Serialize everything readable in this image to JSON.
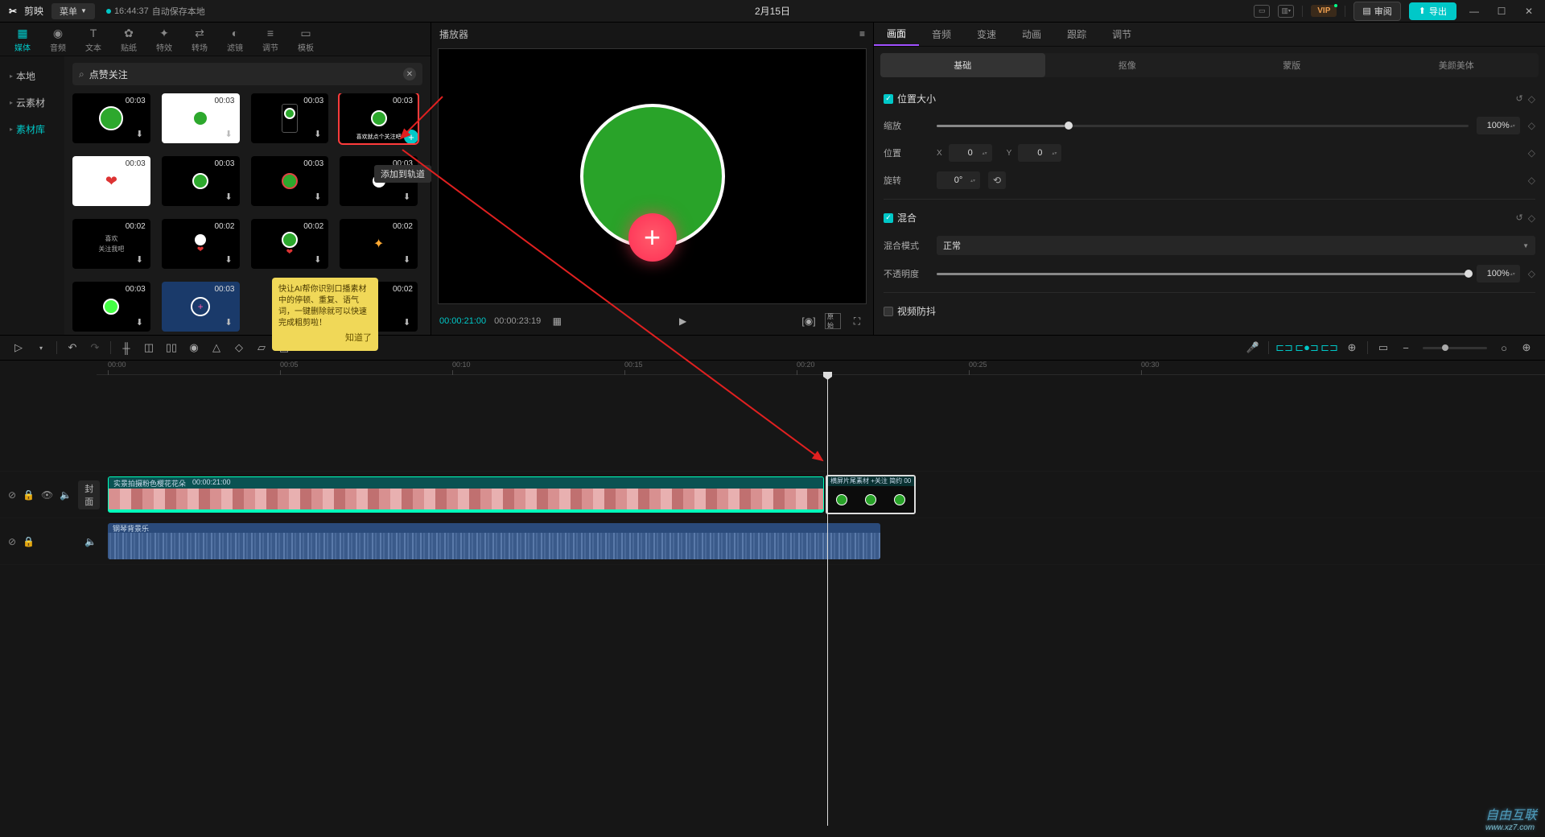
{
  "titlebar": {
    "app_name": "剪映",
    "menu": "菜单",
    "autosave_time": "16:44:37",
    "autosave_text": "自动保存本地",
    "project": "2月15日",
    "vip": "VIP",
    "review": "审阅",
    "export": "导出"
  },
  "top_tabs": [
    {
      "icon": "▦",
      "label": "媒体"
    },
    {
      "icon": "◉",
      "label": "音频"
    },
    {
      "icon": "T",
      "label": "文本"
    },
    {
      "icon": "✿",
      "label": "贴纸"
    },
    {
      "icon": "✦",
      "label": "特效"
    },
    {
      "icon": "⇄",
      "label": "转场"
    },
    {
      "icon": "◐",
      "label": "滤镜"
    },
    {
      "icon": "≡",
      "label": "调节"
    },
    {
      "icon": "▭",
      "label": "模板"
    }
  ],
  "side_nav": [
    {
      "label": "本地"
    },
    {
      "label": "云素材"
    },
    {
      "label": "素材库"
    }
  ],
  "search": {
    "placeholder": "点赞关注"
  },
  "thumbs": [
    {
      "dur": "00:03"
    },
    {
      "dur": "00:03"
    },
    {
      "dur": "00:03"
    },
    {
      "dur": "00:03"
    },
    {
      "dur": "00:03"
    },
    {
      "dur": "00:03"
    },
    {
      "dur": "00:03"
    },
    {
      "dur": "00:03"
    },
    {
      "dur": "00:02"
    },
    {
      "dur": "00:02"
    },
    {
      "dur": "00:02"
    },
    {
      "dur": "00:02"
    },
    {
      "dur": "00:03"
    },
    {
      "dur": "00:03"
    },
    {
      "dur": "",
      "hidden": true
    },
    {
      "dur": "00:02"
    }
  ],
  "thumb_sel_caption": "喜欢就点个关注吧",
  "tooltip_track": "添加到轨道",
  "ai_tip": {
    "text": "快让AI帮你识别口播素材中的停顿、重复、语气词，一键删除就可以快速完成粗剪啦！",
    "know": "知道了"
  },
  "player": {
    "title": "播放器",
    "current": "00:00:21:00",
    "total": "00:00:23:19"
  },
  "inspector": {
    "tabs": [
      "画面",
      "音频",
      "变速",
      "动画",
      "跟踪",
      "调节"
    ],
    "subtabs": [
      "基础",
      "抠像",
      "蒙版",
      "美颜美体"
    ],
    "pos_size": "位置大小",
    "scale": "缩放",
    "scale_val": "100%",
    "position": "位置",
    "x": "0",
    "y": "0",
    "rotate": "旋转",
    "rotate_val": "0°",
    "blend": "混合",
    "blend_mode_label": "混合模式",
    "blend_mode": "正常",
    "opacity": "不透明度",
    "opacity_val": "100%",
    "stabilize": "视频防抖"
  },
  "ruler": [
    "00:00",
    "00:05",
    "00:10",
    "00:15",
    "00:20",
    "00:25",
    "00:30"
  ],
  "track": {
    "cover": "封面",
    "clip1_name": "实景拍摄粉色樱花花朵",
    "clip1_time": "00:00:21:00",
    "clip2_name": "横屏片尾素材 +关注 简约 00",
    "audio_name": "钢琴背景乐"
  },
  "watermark": {
    "brand": "自由互联",
    "url": "www.xz7.com"
  }
}
